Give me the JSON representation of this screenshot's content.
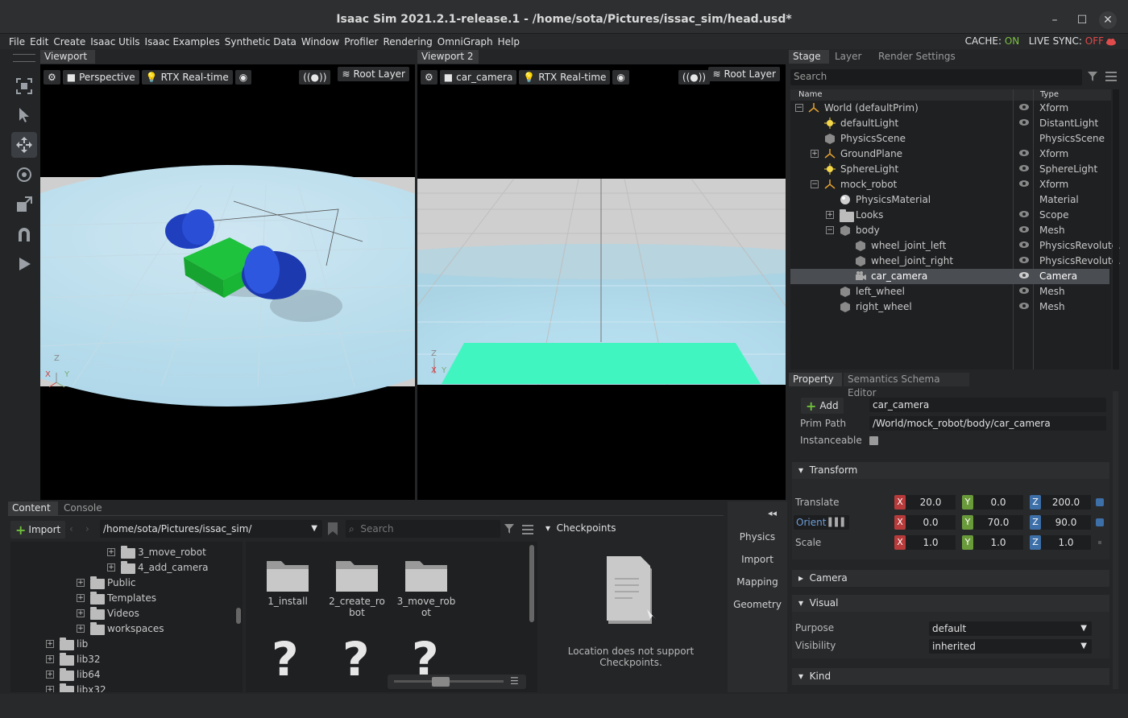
{
  "window": {
    "title": "Isaac Sim 2021.2.1-release.1 - /home/sota/Pictures/issac_sim/head.usd*",
    "minimize": "–",
    "maximize": "☐",
    "close": "✕"
  },
  "menu": [
    "File",
    "Edit",
    "Create",
    "Isaac Utils",
    "Isaac Examples",
    "Synthetic Data",
    "Window",
    "Profiler",
    "Rendering",
    "OmniGraph",
    "Help"
  ],
  "status": {
    "cache_label": "CACHE:",
    "cache_value": "ON",
    "sync_label": "LIVE SYNC:",
    "sync_value": "OFF"
  },
  "viewport1": {
    "tab": "Viewport",
    "camera": "Perspective",
    "renderer": "RTX Real-time",
    "layer": "Root Layer",
    "axis_x": "X",
    "axis_y": "Y",
    "axis_z": "Z"
  },
  "viewport2": {
    "tab": "Viewport 2",
    "camera": "car_camera",
    "renderer": "RTX Real-time",
    "layer": "Root Layer",
    "axis_x": "X",
    "axis_y": "Y",
    "axis_z": "Z"
  },
  "stage": {
    "tabs": [
      "Stage",
      "Layer",
      "Render Settings"
    ],
    "search_placeholder": "Search",
    "col_name": "Name",
    "col_type": "Type",
    "rows": [
      {
        "name": "World (defaultPrim)",
        "type": "Xform"
      },
      {
        "name": "defaultLight",
        "type": "DistantLight"
      },
      {
        "name": "PhysicsScene",
        "type": "PhysicsScene"
      },
      {
        "name": "GroundPlane",
        "type": "Xform"
      },
      {
        "name": "SphereLight",
        "type": "SphereLight"
      },
      {
        "name": "mock_robot",
        "type": "Xform"
      },
      {
        "name": "PhysicsMaterial",
        "type": "Material"
      },
      {
        "name": "Looks",
        "type": "Scope"
      },
      {
        "name": "body",
        "type": "Mesh"
      },
      {
        "name": "wheel_joint_left",
        "type": "PhysicsRevolute."
      },
      {
        "name": "wheel_joint_right",
        "type": "PhysicsRevolute."
      },
      {
        "name": "car_camera",
        "type": "Camera"
      },
      {
        "name": "left_wheel",
        "type": "Mesh"
      },
      {
        "name": "right_wheel",
        "type": "Mesh"
      }
    ]
  },
  "property": {
    "tabs": [
      "Property",
      "Semantics Schema Editor"
    ],
    "add_label": "Add",
    "prim_name": "car_camera",
    "prim_path_label": "Prim Path",
    "prim_path": "/World/mock_robot/body/car_camera",
    "instanceable_label": "Instanceable",
    "transform_label": "Transform",
    "translate_label": "Translate",
    "translate": [
      "20.0",
      "0.0",
      "200.0"
    ],
    "orient_label": "Orient",
    "orient": [
      "0.0",
      "70.0",
      "90.0"
    ],
    "scale_label": "Scale",
    "scale": [
      "1.0",
      "1.0",
      "1.0"
    ],
    "camera_label": "Camera",
    "visual_label": "Visual",
    "purpose_label": "Purpose",
    "purpose": "default",
    "visibility_label": "Visibility",
    "visibility": "inherited",
    "kind_label": "Kind"
  },
  "content": {
    "tabs": [
      "Content",
      "Console"
    ],
    "import_label": "Import",
    "path": "/home/sota/Pictures/issac_sim/",
    "search_placeholder": "Search",
    "tree": [
      "3_move_robot",
      "4_add_camera",
      "Public",
      "Templates",
      "Videos",
      "workspaces",
      "lib",
      "lib32",
      "lib64",
      "libx32"
    ],
    "files": [
      "1_install",
      "2_create_robot",
      "3_move_robot"
    ],
    "checkpoints_label": "Checkpoints",
    "checkpoints_msg": "Location does not support Checkpoints.",
    "side_buttons": [
      "Physics",
      "Import",
      "Mapping",
      "Geometry"
    ]
  },
  "colors": {
    "accent_on": "#7dc142",
    "accent_off": "#e04b4b",
    "selection": "#4a4d52"
  }
}
